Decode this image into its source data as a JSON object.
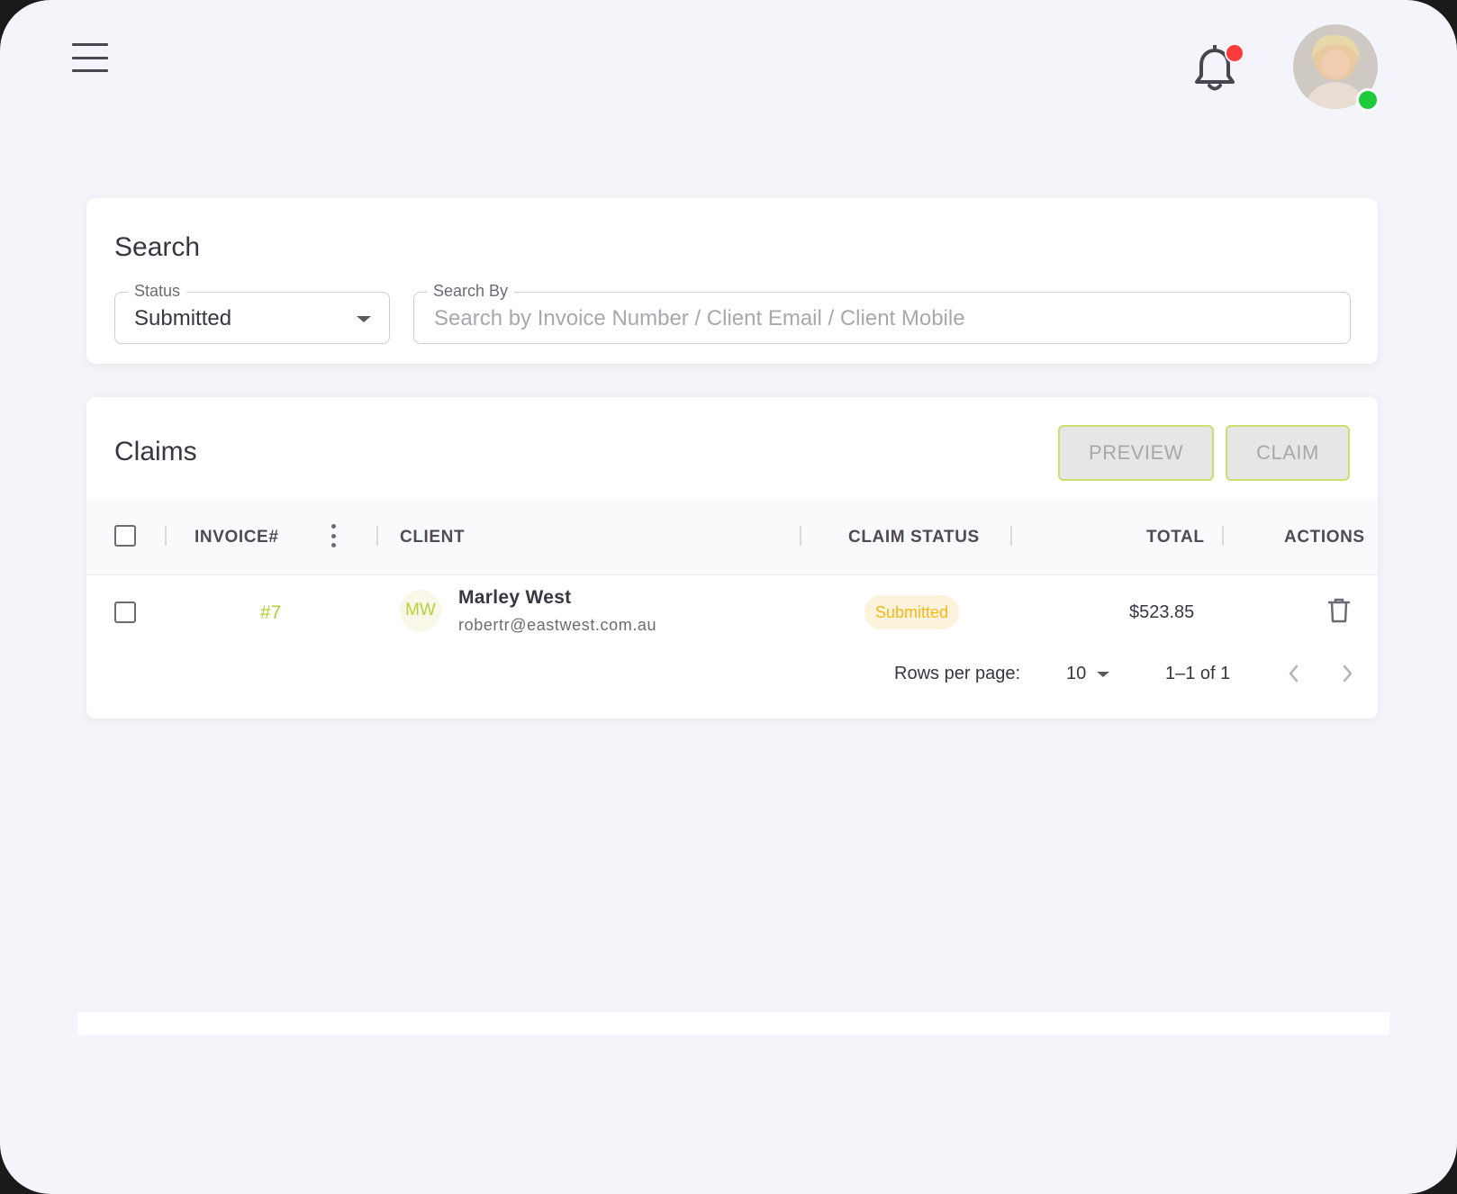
{
  "header": {
    "menu_icon": "hamburger-menu-icon",
    "notification_icon": "bell-icon",
    "notification_badge_color": "#ff3c3c",
    "user_status_color": "#1ecc3b"
  },
  "search": {
    "title": "Search",
    "status_label": "Status",
    "status_value": "Submitted",
    "search_by_label": "Search By",
    "search_by_placeholder": "Search by Invoice Number / Client Email / Client Mobile",
    "search_by_value": ""
  },
  "claims": {
    "title": "Claims",
    "preview_label": "PREVIEW",
    "claim_label": "CLAIM",
    "columns": {
      "invoice": "INVOICE#",
      "client": "CLIENT",
      "claim_status": "CLAIM STATUS",
      "total": "TOTAL",
      "actions": "ACTIONS"
    },
    "rows": [
      {
        "invoice": "#7",
        "client_initials": "MW",
        "client_name": "Marley West",
        "client_email": "robertr@eastwest.com.au",
        "claim_status": "Submitted",
        "total": "$523.85"
      }
    ],
    "pagination": {
      "rows_per_page_label": "Rows per page:",
      "rows_per_page_value": "10",
      "range": "1–1 of 1"
    }
  },
  "colors": {
    "accent": "#b3cd3c",
    "status_chip_bg": "#fdf3dc",
    "status_chip_text": "#f2b81a",
    "background": "#f4f5fa"
  }
}
